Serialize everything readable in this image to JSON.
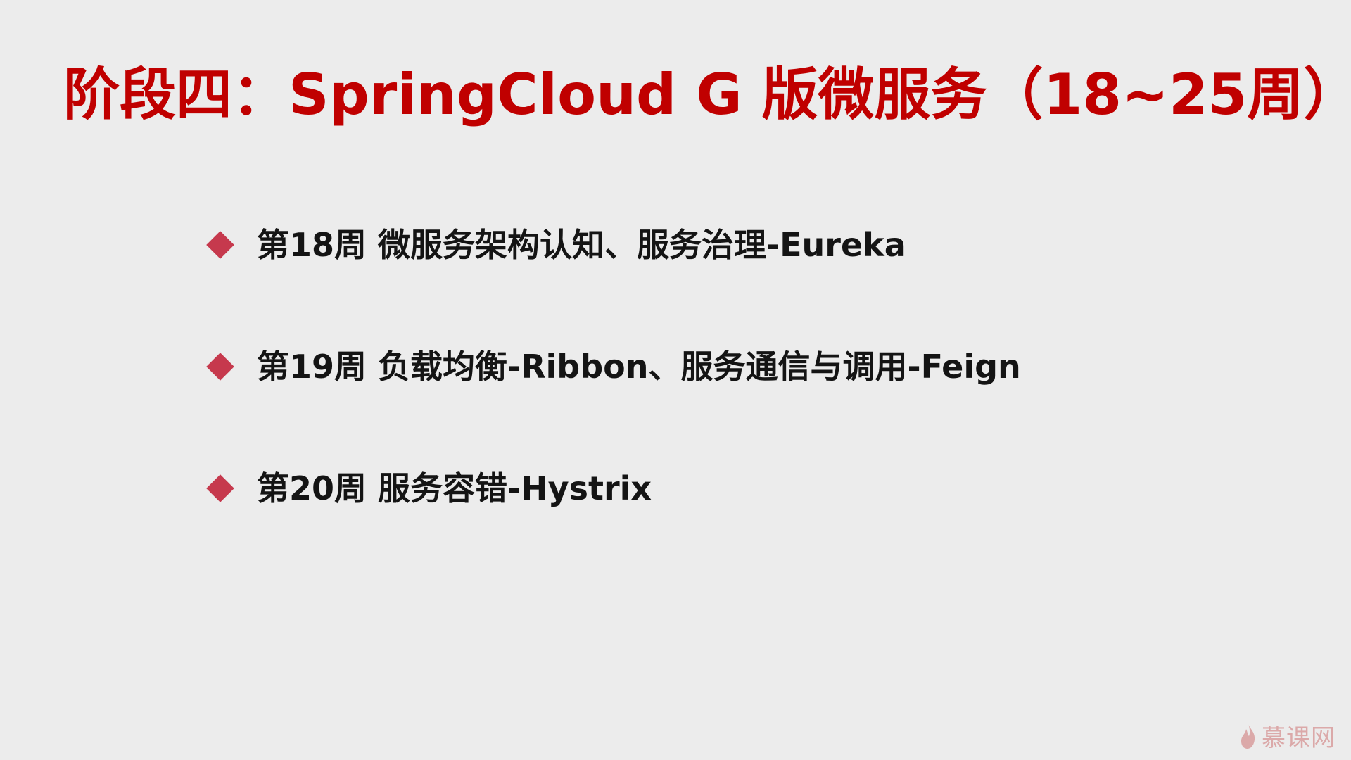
{
  "slide": {
    "title": "阶段四：SpringCloud G 版微服务（18~25周）",
    "accent_color": "#c00000",
    "bullet_color": "#c6394d",
    "background_color": "#ececec",
    "bullets": [
      {
        "text": "第18周 微服务架构认知、服务治理-Eureka"
      },
      {
        "text": "第19周 负载均衡-Ribbon、服务通信与调用-Feign"
      },
      {
        "text": "第20周 服务容错-Hystrix"
      }
    ]
  },
  "watermark": {
    "icon": "flame-icon",
    "text": "慕课网"
  }
}
